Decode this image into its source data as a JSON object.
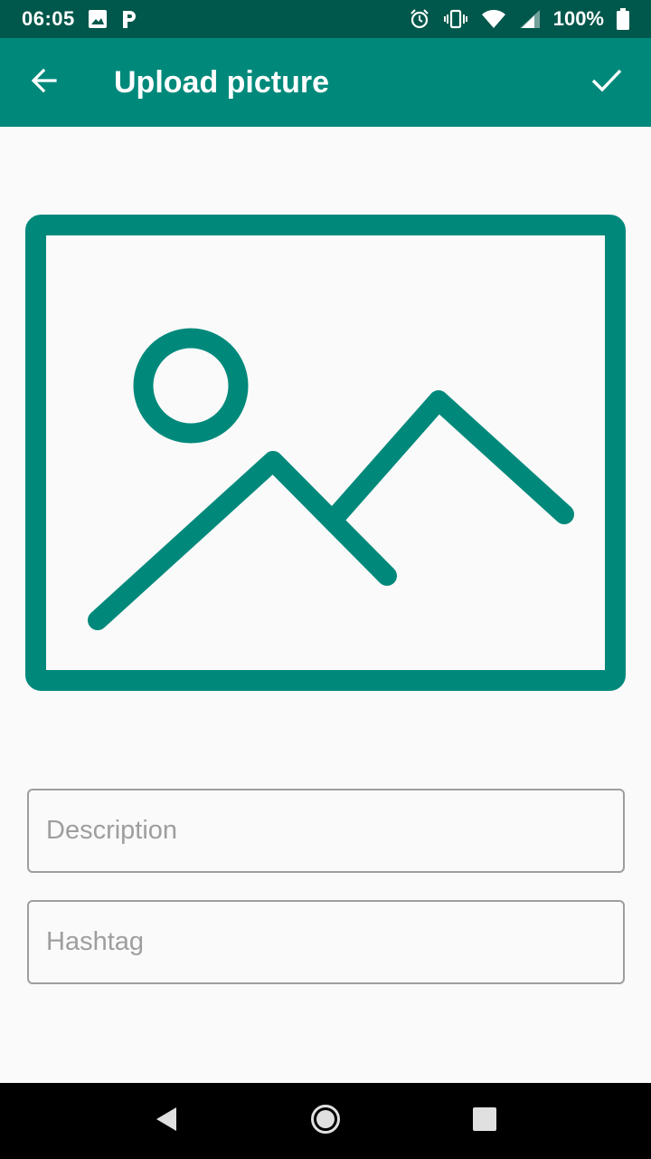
{
  "status_bar": {
    "time": "06:05",
    "battery": "100%",
    "icons": [
      "image-icon",
      "parking-icon",
      "alarm-icon",
      "vibrate-icon",
      "wifi-icon",
      "signal-icon",
      "battery-icon"
    ]
  },
  "app_bar": {
    "title": "Upload picture",
    "back_icon": "arrow-back-icon",
    "confirm_icon": "check-icon"
  },
  "image_picker": {
    "icon": "image-placeholder-icon",
    "color": "#00897b"
  },
  "form": {
    "description": {
      "value": "",
      "placeholder": "Description"
    },
    "hashtag": {
      "value": "",
      "placeholder": "Hashtag"
    }
  },
  "nav_bar": {
    "buttons": [
      "back-triangle-icon",
      "home-circle-icon",
      "recents-square-icon"
    ]
  },
  "colors": {
    "primary": "#00897b",
    "primary_dark": "#00574b",
    "background": "#fafafa",
    "field_border": "#9e9e9e"
  }
}
